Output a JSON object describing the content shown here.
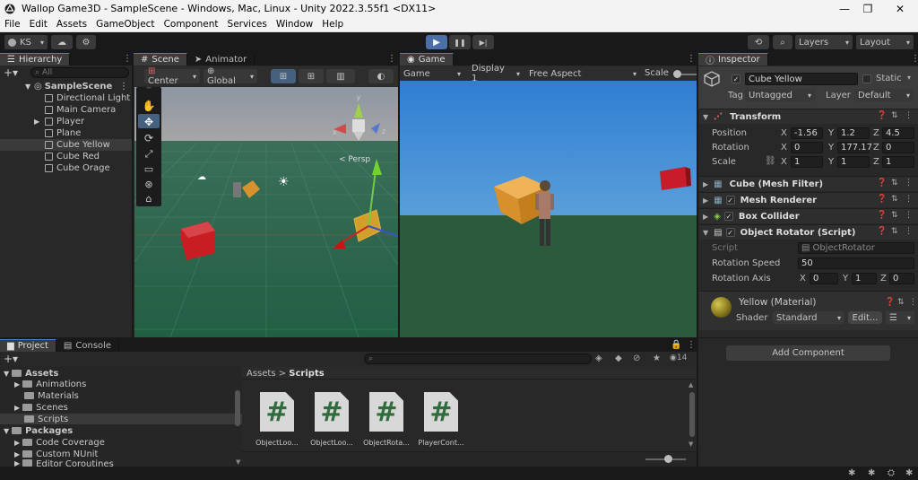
{
  "window": {
    "title": "Wallop Game3D - SampleScene - Windows, Mac, Linux - Unity 2022.3.55f1 <DX11>",
    "minimize": "—",
    "maximize": "❐",
    "close": "✕"
  },
  "menu": [
    "File",
    "Edit",
    "Assets",
    "GameObject",
    "Component",
    "Services",
    "Window",
    "Help"
  ],
  "toolbar": {
    "account": "KS",
    "layers": "Layers",
    "layout": "Layout",
    "play_icon": "▶",
    "pause_icon": "❚❚",
    "step_icon": "▶|"
  },
  "hierarchy": {
    "tab": "Hierarchy",
    "search_placeholder": "All",
    "scene": "SampleScene",
    "items": [
      "Directional Light",
      "Main Camera",
      "Player",
      "Plane",
      "Cube Yellow",
      "Cube Red",
      "Cube Orage"
    ],
    "selected": "Cube Yellow"
  },
  "scene": {
    "tabs": [
      "Scene",
      "Animator"
    ],
    "pivot": "Center",
    "space": "Global",
    "persp": "< Persp",
    "gizmo_axes": [
      "y",
      "x",
      "z"
    ]
  },
  "game": {
    "tab": "Game",
    "mode": "Game",
    "display": "Display 1",
    "aspect": "Free Aspect",
    "scale_label": "Scale"
  },
  "inspector": {
    "tab": "Inspector",
    "object_name": "Cube Yellow",
    "static_label": "Static",
    "tag_label": "Tag",
    "tag_value": "Untagged",
    "layer_label": "Layer",
    "layer_value": "Default",
    "transform": {
      "title": "Transform",
      "position_label": "Position",
      "rotation_label": "Rotation",
      "scale_label": "Scale",
      "position": {
        "x": "-1.56",
        "y": "1.2",
        "z": "4.5"
      },
      "rotation": {
        "x": "0",
        "y": "177.17",
        "z": "0"
      },
      "scale": {
        "x": "1",
        "y": "1",
        "z": "1"
      }
    },
    "components": [
      "Cube (Mesh Filter)",
      "Mesh Renderer",
      "Box Collider",
      "Object Rotator (Script)"
    ],
    "script": {
      "script_label": "Script",
      "script_value": "ObjectRotator",
      "speed_label": "Rotation Speed",
      "speed_value": "50",
      "axis_label": "Rotation Axis",
      "axis": {
        "x": "0",
        "y": "1",
        "z": "0"
      }
    },
    "material": {
      "name": "Yellow (Material)",
      "shader_label": "Shader",
      "shader_value": "Standard",
      "edit_label": "Edit...",
      "color": "#8a7d1c"
    },
    "add_component": "Add Component"
  },
  "project": {
    "tabs": [
      "Project",
      "Console"
    ],
    "tree": [
      {
        "label": "Assets",
        "level": 0,
        "bold": true
      },
      {
        "label": "Animations",
        "level": 1
      },
      {
        "label": "Materials",
        "level": 1
      },
      {
        "label": "Scenes",
        "level": 1
      },
      {
        "label": "Scripts",
        "level": 1,
        "selected": true
      },
      {
        "label": "Packages",
        "level": 0,
        "bold": true
      },
      {
        "label": "Code Coverage",
        "level": 1
      },
      {
        "label": "Custom NUnit",
        "level": 1
      },
      {
        "label": "Editor Coroutines",
        "level": 1
      }
    ],
    "breadcrumb": [
      "Assets",
      "Scripts"
    ],
    "count": "14",
    "assets": [
      "ObjectLoo...",
      "ObjectLoo...",
      "ObjectRota...",
      "PlayerCont..."
    ],
    "script_glyph": "#"
  },
  "colors": {
    "accent": "#4d7ad4",
    "sky_top": "#7f8a98",
    "ground": "#2f6e52",
    "game_sky": "#3b8bd8",
    "game_ground": "#2a5a3c",
    "cube_orange": "#e39a2c",
    "cube_red": "#c8161e"
  }
}
